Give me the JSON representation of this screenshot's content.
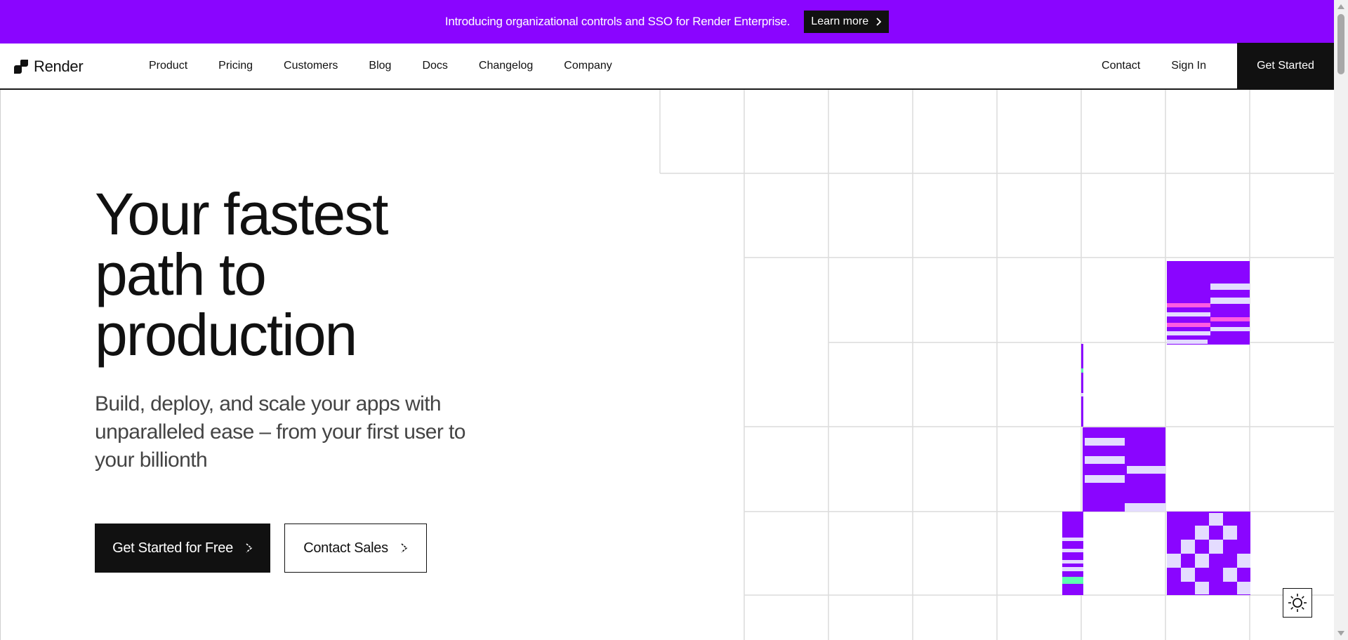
{
  "banner": {
    "text": "Introducing organizational controls and SSO for Render Enterprise.",
    "button_label": "Learn more"
  },
  "nav": {
    "logo_text": "Render",
    "links": [
      "Product",
      "Pricing",
      "Customers",
      "Blog",
      "Docs",
      "Changelog",
      "Company"
    ],
    "contact": "Contact",
    "sign_in": "Sign In",
    "get_started": "Get Started"
  },
  "hero": {
    "title_lines": [
      "Your fastest",
      "path to",
      "production"
    ],
    "subtitle": "Build, deploy, and scale your apps with unparalleled ease – from your first user to your billionth",
    "primary_cta": "Get Started for Free",
    "secondary_cta": "Contact Sales"
  },
  "colors": {
    "brand_purple": "#8a05ff",
    "light_lavender": "#e4dcff",
    "pink_accent": "#ff5ce1",
    "green_accent": "#5cffaf",
    "dark": "#111111",
    "grid_line": "#dcdcdc"
  },
  "icons": {
    "theme_toggle": "sun-icon",
    "chevron": "chevron-right-icon"
  }
}
